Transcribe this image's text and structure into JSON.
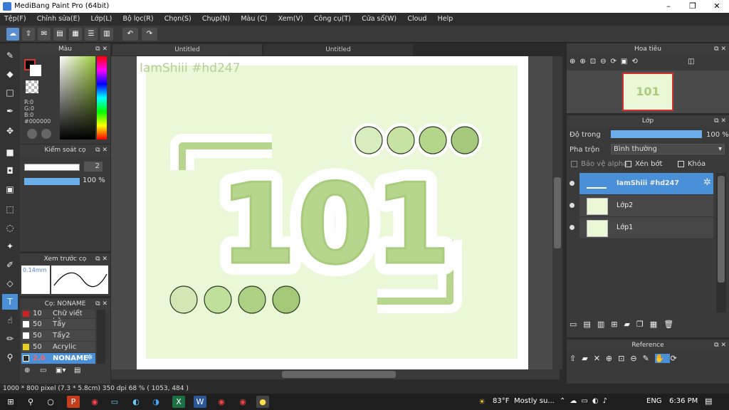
{
  "app": {
    "title": "MediBang Paint Pro (64bit)"
  },
  "menu": [
    "Tệp(F)",
    "Chỉnh sửa(E)",
    "Lớp(L)",
    "Bộ lọc(R)",
    "Chọn(S)",
    "Chụp(N)",
    "Màu (C)",
    "Xem(V)",
    "Công cụ(T)",
    "Cửa sổ(W)",
    "Cloud",
    "Help"
  ],
  "tabs": [
    "Untitled",
    "Untitled"
  ],
  "color_panel": {
    "title": "Màu",
    "r": "R:0",
    "g": "G:0",
    "b": "B:0",
    "hex": "#000000"
  },
  "brush_control": {
    "title": "Kiểm soát cọ",
    "size": "2",
    "opacity": "100 %"
  },
  "brush_preview": {
    "title": "Xem trước cọ",
    "size": "0.14mm"
  },
  "brush_list": {
    "title": "Cọ: NONAME",
    "items": [
      {
        "size": "10",
        "name": "Chữ viết bằng",
        "color": "#cc2222"
      },
      {
        "size": "50",
        "name": "Tẩy",
        "color": "#ffffff"
      },
      {
        "size": "50",
        "name": "Tẩy2",
        "color": "#ffffff"
      },
      {
        "size": "50",
        "name": "Acrylic",
        "color": "#e8d020"
      },
      {
        "size": "2.0",
        "name": "NONAME",
        "color": "#2b2b2b"
      }
    ]
  },
  "canvas": {
    "watermark": "IamShiii #hd247",
    "headline": "101"
  },
  "status": {
    "text": "1000 * 800 pixel   (7.3 * 5.8cm)   350 dpi   68 %   ( 1053, 484 )"
  },
  "navigator": {
    "title": "Hoa tiêu"
  },
  "layers": {
    "title": "Lớp",
    "opacity_label": "Độ trong",
    "opacity_value": "100 %",
    "blend_label": "Pha trộn",
    "blend_value": "Bình thường",
    "protect_alpha": "Bảo vệ alpha",
    "clipping": "Xén bớt",
    "lock": "Khóa",
    "items": [
      "IamShiii #hd247",
      "Lớp2",
      "Lớp1"
    ]
  },
  "reference": {
    "title": "Reference"
  },
  "taskbar": {
    "weather": "83°F",
    "weather_desc": "Mostly su...",
    "lang": "ENG",
    "time": "6:36 PM"
  },
  "colors": {
    "accent": "#4a90d9",
    "canvas_bg": "#eaf8d8",
    "art_green": "#b5d68c"
  }
}
